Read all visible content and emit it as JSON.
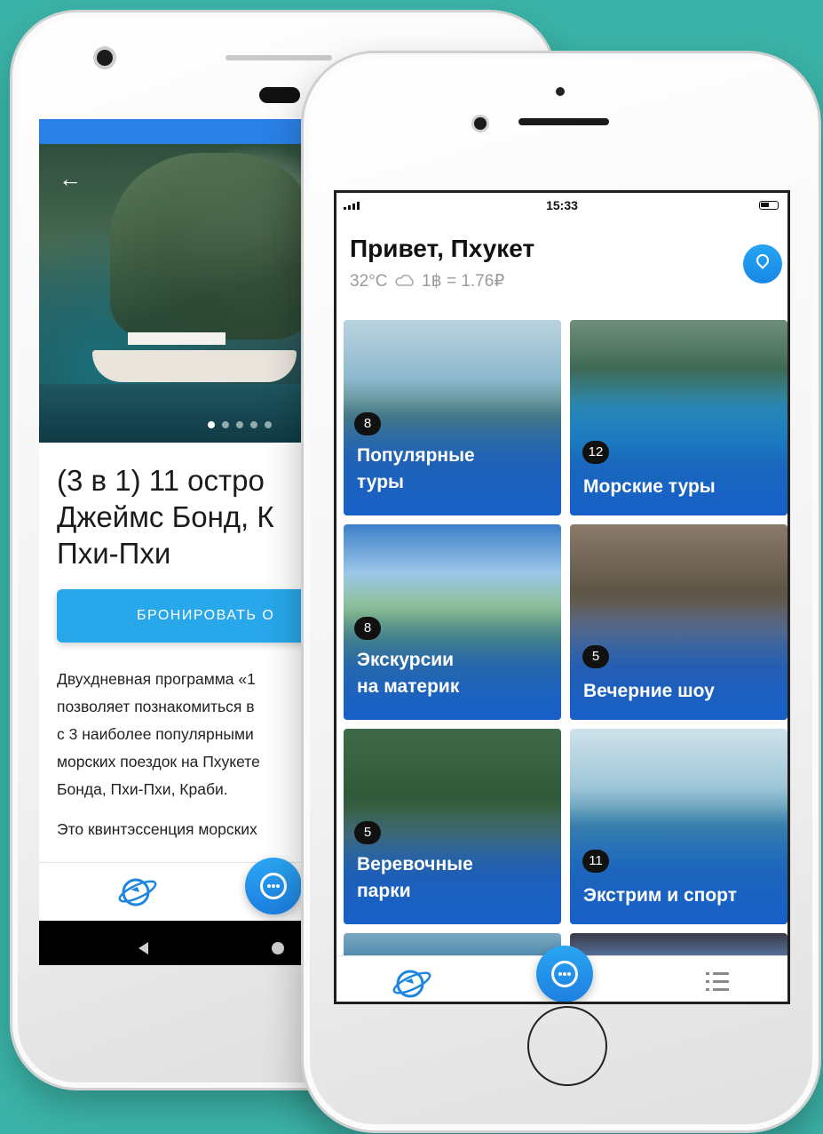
{
  "colors": {
    "background": "#3bb3a8",
    "accent": "#28a7ea",
    "android_statusbar": "#2a80e5"
  },
  "android": {
    "back_icon": "arrow-left-icon",
    "tour_title": "(3 в 1) 11 остро\nДжеймс Бонд, К\nПхи-Пхи",
    "book_button": "БРОНИРОВАТЬ О",
    "description": "Двухдневная программа «1\nпозволяет познакомиться в\nс 3 наиболее популярными \nморских поездок на Пхукете\nБонда, Пхи-Пхи, Краби.",
    "description2": "Это квинтэссенция морских",
    "tabbar": {
      "home_icon": "globe-plane-icon",
      "chat_icon": "chat-bubble-icon"
    },
    "navbar": {
      "back": "nav-back-icon",
      "home": "nav-home-icon"
    }
  },
  "iphone": {
    "status": {
      "time": "15:33",
      "signal_icon": "signal-icon",
      "battery_icon": "battery-icon"
    },
    "greeting": "Привет, Пхукет",
    "weather": {
      "temp": "32°C",
      "icon": "cloud-icon",
      "rate": "1฿ = 1.76₽"
    },
    "location_icon": "location-pin-icon",
    "categories": [
      {
        "label": "Популярные\nтуры",
        "count": "8"
      },
      {
        "label": "Морские туры",
        "count": "12"
      },
      {
        "label": "Экскурсии\nна материк",
        "count": "8"
      },
      {
        "label": "Вечерние шоу",
        "count": "5"
      },
      {
        "label": "Веревочные\nпарки",
        "count": "5"
      },
      {
        "label": "Экстрим и спорт",
        "count": "11"
      }
    ],
    "tabbar": {
      "home_icon": "globe-plane-icon",
      "chat_icon": "chat-bubble-icon",
      "menu_icon": "list-menu-icon"
    }
  }
}
